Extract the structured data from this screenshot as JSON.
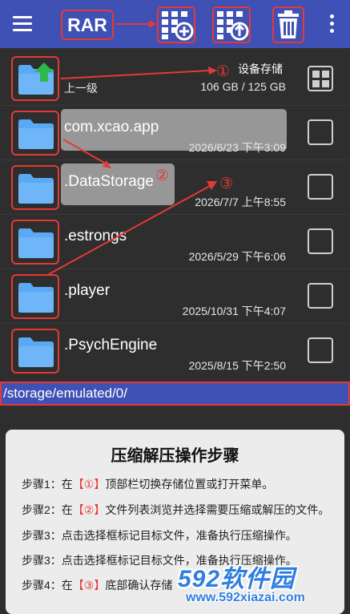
{
  "toolbar": {
    "archive_label": "RAR"
  },
  "parent_row": {
    "label": "上一级",
    "storage_label": "设备存储",
    "storage_size": "106 GB / 125 GB",
    "annotation": "①"
  },
  "files": [
    {
      "name": "com.xcao.app",
      "date": "2026/6/23 下午3:09"
    },
    {
      "name": ".DataStorage",
      "date": "2026/7/7 上午8:55",
      "annotation": "②"
    },
    {
      "name": ".estrongs",
      "date": "2026/5/29 下午6:06"
    },
    {
      "name": ".player",
      "date": "2025/10/31 下午4:07"
    },
    {
      "name": ".PsychEngine",
      "date": "2025/8/15 下午2:50"
    }
  ],
  "arrow_annotation": "③",
  "path": "/storage/emulated/0/",
  "help": {
    "title": "压缩解压操作步骤",
    "steps": [
      {
        "prefix": "步骤1：在",
        "mark": "【①】",
        "text": "顶部栏切换存储位置或打开菜单。"
      },
      {
        "prefix": "步骤2：在",
        "mark": "【②】",
        "text": "文件列表浏览并选择需要压缩或解压的文件。"
      },
      {
        "prefix": "步骤3：点击选择框标记目标文件，准备执行压缩操作。",
        "mark": "",
        "text": ""
      },
      {
        "prefix": "步骤3：点击选择框标记目标文件，准备执行压缩操作。",
        "mark": "",
        "text": ""
      },
      {
        "prefix": "步骤4：在",
        "mark": "【③】",
        "text": "底部确认存储"
      }
    ]
  },
  "watermark": {
    "brand": "592软件园",
    "url": "www.592xiazai.com"
  },
  "colors": {
    "primary": "#3f51b5",
    "annotation_red": "#e53935",
    "folder_blue": "#5aa9f5",
    "up_arrow_green": "#2fb84a"
  }
}
